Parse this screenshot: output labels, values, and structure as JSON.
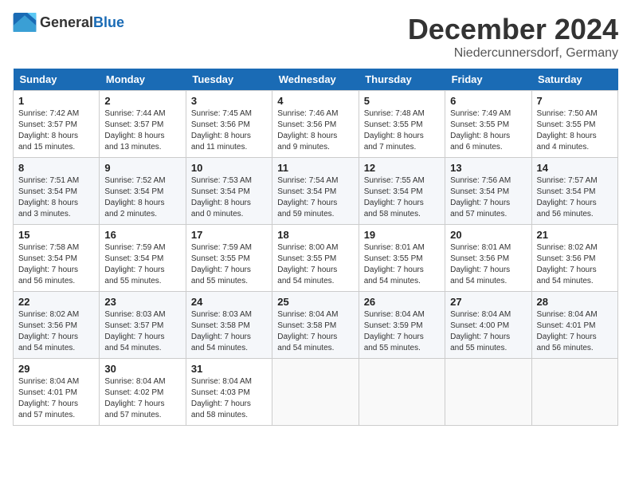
{
  "header": {
    "logo": {
      "general": "General",
      "blue": "Blue"
    },
    "title": "December 2024",
    "subtitle": "Niedercunnersdorf, Germany"
  },
  "calendar": {
    "days_of_week": [
      "Sunday",
      "Monday",
      "Tuesday",
      "Wednesday",
      "Thursday",
      "Friday",
      "Saturday"
    ],
    "weeks": [
      [
        {
          "day": "1",
          "sunrise": "7:42 AM",
          "sunset": "3:57 PM",
          "daylight": "8 hours and 15 minutes."
        },
        {
          "day": "2",
          "sunrise": "7:44 AM",
          "sunset": "3:57 PM",
          "daylight": "8 hours and 13 minutes."
        },
        {
          "day": "3",
          "sunrise": "7:45 AM",
          "sunset": "3:56 PM",
          "daylight": "8 hours and 11 minutes."
        },
        {
          "day": "4",
          "sunrise": "7:46 AM",
          "sunset": "3:56 PM",
          "daylight": "8 hours and 9 minutes."
        },
        {
          "day": "5",
          "sunrise": "7:48 AM",
          "sunset": "3:55 PM",
          "daylight": "8 hours and 7 minutes."
        },
        {
          "day": "6",
          "sunrise": "7:49 AM",
          "sunset": "3:55 PM",
          "daylight": "8 hours and 6 minutes."
        },
        {
          "day": "7",
          "sunrise": "7:50 AM",
          "sunset": "3:55 PM",
          "daylight": "8 hours and 4 minutes."
        }
      ],
      [
        {
          "day": "8",
          "sunrise": "7:51 AM",
          "sunset": "3:54 PM",
          "daylight": "8 hours and 3 minutes."
        },
        {
          "day": "9",
          "sunrise": "7:52 AM",
          "sunset": "3:54 PM",
          "daylight": "8 hours and 2 minutes."
        },
        {
          "day": "10",
          "sunrise": "7:53 AM",
          "sunset": "3:54 PM",
          "daylight": "8 hours and 0 minutes."
        },
        {
          "day": "11",
          "sunrise": "7:54 AM",
          "sunset": "3:54 PM",
          "daylight": "7 hours and 59 minutes."
        },
        {
          "day": "12",
          "sunrise": "7:55 AM",
          "sunset": "3:54 PM",
          "daylight": "7 hours and 58 minutes."
        },
        {
          "day": "13",
          "sunrise": "7:56 AM",
          "sunset": "3:54 PM",
          "daylight": "7 hours and 57 minutes."
        },
        {
          "day": "14",
          "sunrise": "7:57 AM",
          "sunset": "3:54 PM",
          "daylight": "7 hours and 56 minutes."
        }
      ],
      [
        {
          "day": "15",
          "sunrise": "7:58 AM",
          "sunset": "3:54 PM",
          "daylight": "7 hours and 56 minutes."
        },
        {
          "day": "16",
          "sunrise": "7:59 AM",
          "sunset": "3:54 PM",
          "daylight": "7 hours and 55 minutes."
        },
        {
          "day": "17",
          "sunrise": "7:59 AM",
          "sunset": "3:55 PM",
          "daylight": "7 hours and 55 minutes."
        },
        {
          "day": "18",
          "sunrise": "8:00 AM",
          "sunset": "3:55 PM",
          "daylight": "7 hours and 54 minutes."
        },
        {
          "day": "19",
          "sunrise": "8:01 AM",
          "sunset": "3:55 PM",
          "daylight": "7 hours and 54 minutes."
        },
        {
          "day": "20",
          "sunrise": "8:01 AM",
          "sunset": "3:56 PM",
          "daylight": "7 hours and 54 minutes."
        },
        {
          "day": "21",
          "sunrise": "8:02 AM",
          "sunset": "3:56 PM",
          "daylight": "7 hours and 54 minutes."
        }
      ],
      [
        {
          "day": "22",
          "sunrise": "8:02 AM",
          "sunset": "3:56 PM",
          "daylight": "7 hours and 54 minutes."
        },
        {
          "day": "23",
          "sunrise": "8:03 AM",
          "sunset": "3:57 PM",
          "daylight": "7 hours and 54 minutes."
        },
        {
          "day": "24",
          "sunrise": "8:03 AM",
          "sunset": "3:58 PM",
          "daylight": "7 hours and 54 minutes."
        },
        {
          "day": "25",
          "sunrise": "8:04 AM",
          "sunset": "3:58 PM",
          "daylight": "7 hours and 54 minutes."
        },
        {
          "day": "26",
          "sunrise": "8:04 AM",
          "sunset": "3:59 PM",
          "daylight": "7 hours and 55 minutes."
        },
        {
          "day": "27",
          "sunrise": "8:04 AM",
          "sunset": "4:00 PM",
          "daylight": "7 hours and 55 minutes."
        },
        {
          "day": "28",
          "sunrise": "8:04 AM",
          "sunset": "4:01 PM",
          "daylight": "7 hours and 56 minutes."
        }
      ],
      [
        {
          "day": "29",
          "sunrise": "8:04 AM",
          "sunset": "4:01 PM",
          "daylight": "7 hours and 57 minutes."
        },
        {
          "day": "30",
          "sunrise": "8:04 AM",
          "sunset": "4:02 PM",
          "daylight": "7 hours and 57 minutes."
        },
        {
          "day": "31",
          "sunrise": "8:04 AM",
          "sunset": "4:03 PM",
          "daylight": "7 hours and 58 minutes."
        },
        null,
        null,
        null,
        null
      ]
    ]
  }
}
